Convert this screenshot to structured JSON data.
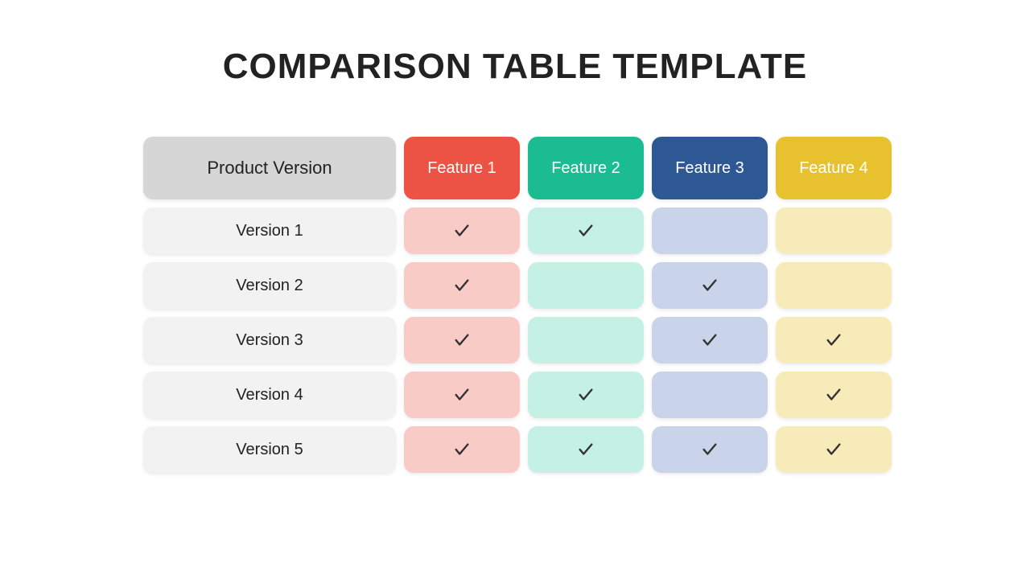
{
  "title": "COMPARISON TABLE TEMPLATE",
  "table": {
    "row_header": "Product Version",
    "features": [
      "Feature 1",
      "Feature 2",
      "Feature 3",
      "Feature 4"
    ],
    "feature_colors": {
      "header": [
        "#ed5345",
        "#1bbc91",
        "#2d5893",
        "#e8c22e"
      ],
      "cell": [
        "#f8cbc6",
        "#c4f1e3",
        "#c9d4ea",
        "#f6ebb9"
      ]
    },
    "rows": [
      {
        "label": "Version 1",
        "values": [
          true,
          true,
          false,
          false
        ]
      },
      {
        "label": "Version 2",
        "values": [
          true,
          false,
          true,
          false
        ]
      },
      {
        "label": "Version 3",
        "values": [
          true,
          false,
          true,
          true
        ]
      },
      {
        "label": "Version 4",
        "values": [
          true,
          true,
          false,
          true
        ]
      },
      {
        "label": "Version 5",
        "values": [
          true,
          true,
          true,
          true
        ]
      }
    ]
  }
}
